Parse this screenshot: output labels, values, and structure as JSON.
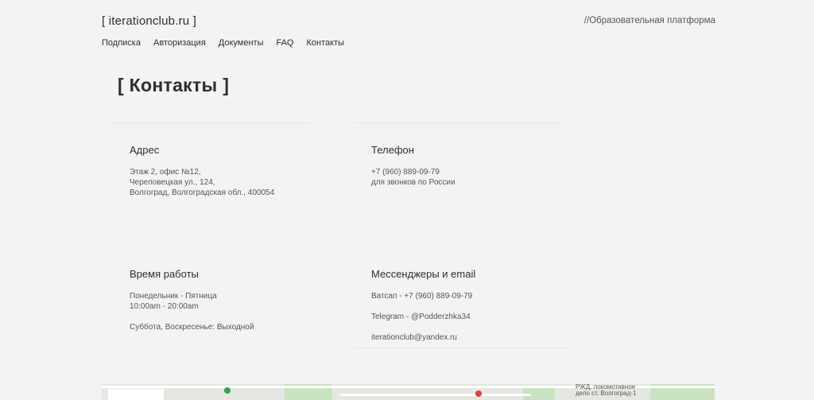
{
  "header": {
    "logo": "[ iterationclub.ru ]",
    "tagline": "//Образовательная платформа"
  },
  "nav": {
    "items": [
      "Подписка",
      "Авторизация",
      "Документы",
      "FAQ",
      "Контакты"
    ]
  },
  "page_title": "[ Контакты ]",
  "cards": {
    "address": {
      "title": "Адрес",
      "lines": [
        "Этаж 2, офис №12,",
        "Череповецкая ул., 124,",
        "Волгоград, Волгоградская обл., 400054"
      ]
    },
    "phone": {
      "title": "Телефон",
      "lines": [
        "+7 (960) 889-09-79",
        "для звонков по России"
      ]
    },
    "hours": {
      "title": "Время работы",
      "lines": [
        "Понедельник - Пятница",
        "10:00am - 20:00am",
        "Суббота, Воскресенье: Выходной"
      ]
    },
    "messengers": {
      "title": "Мессенджеры и email",
      "lines": [
        "Ватсап - +7 (960) 889-09-79",
        "Telegram - @Podderzhka34",
        "iterationclub@yandex.ru"
      ]
    }
  },
  "map": {
    "label_1": "РЖД, локомотивное",
    "label_2": "депо ст. Волгоград-1"
  }
}
